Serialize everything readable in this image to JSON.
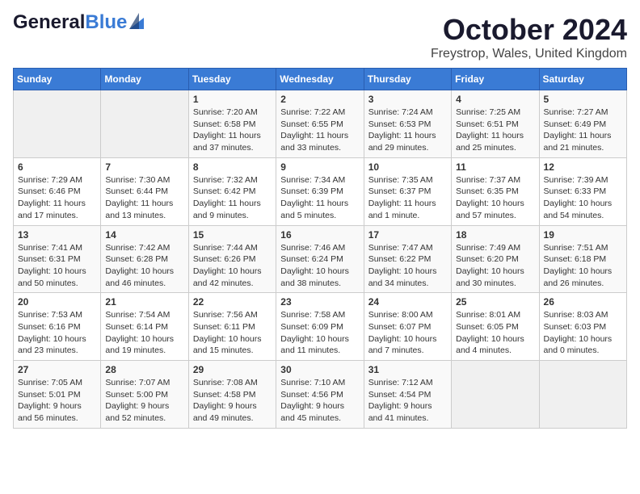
{
  "header": {
    "logo_general": "General",
    "logo_blue": "Blue",
    "month_title": "October 2024",
    "location": "Freystrop, Wales, United Kingdom"
  },
  "days_of_week": [
    "Sunday",
    "Monday",
    "Tuesday",
    "Wednesday",
    "Thursday",
    "Friday",
    "Saturday"
  ],
  "weeks": [
    [
      {
        "day": "",
        "sunrise": "",
        "sunset": "",
        "daylight": ""
      },
      {
        "day": "",
        "sunrise": "",
        "sunset": "",
        "daylight": ""
      },
      {
        "day": "1",
        "sunrise": "Sunrise: 7:20 AM",
        "sunset": "Sunset: 6:58 PM",
        "daylight": "Daylight: 11 hours and 37 minutes."
      },
      {
        "day": "2",
        "sunrise": "Sunrise: 7:22 AM",
        "sunset": "Sunset: 6:55 PM",
        "daylight": "Daylight: 11 hours and 33 minutes."
      },
      {
        "day": "3",
        "sunrise": "Sunrise: 7:24 AM",
        "sunset": "Sunset: 6:53 PM",
        "daylight": "Daylight: 11 hours and 29 minutes."
      },
      {
        "day": "4",
        "sunrise": "Sunrise: 7:25 AM",
        "sunset": "Sunset: 6:51 PM",
        "daylight": "Daylight: 11 hours and 25 minutes."
      },
      {
        "day": "5",
        "sunrise": "Sunrise: 7:27 AM",
        "sunset": "Sunset: 6:49 PM",
        "daylight": "Daylight: 11 hours and 21 minutes."
      }
    ],
    [
      {
        "day": "6",
        "sunrise": "Sunrise: 7:29 AM",
        "sunset": "Sunset: 6:46 PM",
        "daylight": "Daylight: 11 hours and 17 minutes."
      },
      {
        "day": "7",
        "sunrise": "Sunrise: 7:30 AM",
        "sunset": "Sunset: 6:44 PM",
        "daylight": "Daylight: 11 hours and 13 minutes."
      },
      {
        "day": "8",
        "sunrise": "Sunrise: 7:32 AM",
        "sunset": "Sunset: 6:42 PM",
        "daylight": "Daylight: 11 hours and 9 minutes."
      },
      {
        "day": "9",
        "sunrise": "Sunrise: 7:34 AM",
        "sunset": "Sunset: 6:39 PM",
        "daylight": "Daylight: 11 hours and 5 minutes."
      },
      {
        "day": "10",
        "sunrise": "Sunrise: 7:35 AM",
        "sunset": "Sunset: 6:37 PM",
        "daylight": "Daylight: 11 hours and 1 minute."
      },
      {
        "day": "11",
        "sunrise": "Sunrise: 7:37 AM",
        "sunset": "Sunset: 6:35 PM",
        "daylight": "Daylight: 10 hours and 57 minutes."
      },
      {
        "day": "12",
        "sunrise": "Sunrise: 7:39 AM",
        "sunset": "Sunset: 6:33 PM",
        "daylight": "Daylight: 10 hours and 54 minutes."
      }
    ],
    [
      {
        "day": "13",
        "sunrise": "Sunrise: 7:41 AM",
        "sunset": "Sunset: 6:31 PM",
        "daylight": "Daylight: 10 hours and 50 minutes."
      },
      {
        "day": "14",
        "sunrise": "Sunrise: 7:42 AM",
        "sunset": "Sunset: 6:28 PM",
        "daylight": "Daylight: 10 hours and 46 minutes."
      },
      {
        "day": "15",
        "sunrise": "Sunrise: 7:44 AM",
        "sunset": "Sunset: 6:26 PM",
        "daylight": "Daylight: 10 hours and 42 minutes."
      },
      {
        "day": "16",
        "sunrise": "Sunrise: 7:46 AM",
        "sunset": "Sunset: 6:24 PM",
        "daylight": "Daylight: 10 hours and 38 minutes."
      },
      {
        "day": "17",
        "sunrise": "Sunrise: 7:47 AM",
        "sunset": "Sunset: 6:22 PM",
        "daylight": "Daylight: 10 hours and 34 minutes."
      },
      {
        "day": "18",
        "sunrise": "Sunrise: 7:49 AM",
        "sunset": "Sunset: 6:20 PM",
        "daylight": "Daylight: 10 hours and 30 minutes."
      },
      {
        "day": "19",
        "sunrise": "Sunrise: 7:51 AM",
        "sunset": "Sunset: 6:18 PM",
        "daylight": "Daylight: 10 hours and 26 minutes."
      }
    ],
    [
      {
        "day": "20",
        "sunrise": "Sunrise: 7:53 AM",
        "sunset": "Sunset: 6:16 PM",
        "daylight": "Daylight: 10 hours and 23 minutes."
      },
      {
        "day": "21",
        "sunrise": "Sunrise: 7:54 AM",
        "sunset": "Sunset: 6:14 PM",
        "daylight": "Daylight: 10 hours and 19 minutes."
      },
      {
        "day": "22",
        "sunrise": "Sunrise: 7:56 AM",
        "sunset": "Sunset: 6:11 PM",
        "daylight": "Daylight: 10 hours and 15 minutes."
      },
      {
        "day": "23",
        "sunrise": "Sunrise: 7:58 AM",
        "sunset": "Sunset: 6:09 PM",
        "daylight": "Daylight: 10 hours and 11 minutes."
      },
      {
        "day": "24",
        "sunrise": "Sunrise: 8:00 AM",
        "sunset": "Sunset: 6:07 PM",
        "daylight": "Daylight: 10 hours and 7 minutes."
      },
      {
        "day": "25",
        "sunrise": "Sunrise: 8:01 AM",
        "sunset": "Sunset: 6:05 PM",
        "daylight": "Daylight: 10 hours and 4 minutes."
      },
      {
        "day": "26",
        "sunrise": "Sunrise: 8:03 AM",
        "sunset": "Sunset: 6:03 PM",
        "daylight": "Daylight: 10 hours and 0 minutes."
      }
    ],
    [
      {
        "day": "27",
        "sunrise": "Sunrise: 7:05 AM",
        "sunset": "Sunset: 5:01 PM",
        "daylight": "Daylight: 9 hours and 56 minutes."
      },
      {
        "day": "28",
        "sunrise": "Sunrise: 7:07 AM",
        "sunset": "Sunset: 5:00 PM",
        "daylight": "Daylight: 9 hours and 52 minutes."
      },
      {
        "day": "29",
        "sunrise": "Sunrise: 7:08 AM",
        "sunset": "Sunset: 4:58 PM",
        "daylight": "Daylight: 9 hours and 49 minutes."
      },
      {
        "day": "30",
        "sunrise": "Sunrise: 7:10 AM",
        "sunset": "Sunset: 4:56 PM",
        "daylight": "Daylight: 9 hours and 45 minutes."
      },
      {
        "day": "31",
        "sunrise": "Sunrise: 7:12 AM",
        "sunset": "Sunset: 4:54 PM",
        "daylight": "Daylight: 9 hours and 41 minutes."
      },
      {
        "day": "",
        "sunrise": "",
        "sunset": "",
        "daylight": ""
      },
      {
        "day": "",
        "sunrise": "",
        "sunset": "",
        "daylight": ""
      }
    ]
  ]
}
